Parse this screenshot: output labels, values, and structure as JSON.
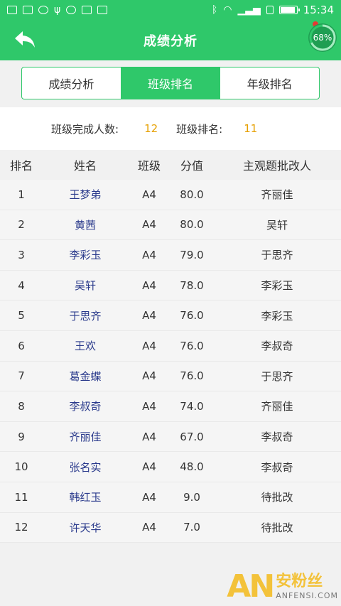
{
  "status_bar": {
    "time": "15:34",
    "battery_level": 0.9,
    "left_icons": [
      "calendar-icon",
      "image-icon",
      "shield-icon",
      "usb-icon",
      "globe-icon",
      "apps-icon",
      "browser-icon"
    ],
    "right_icons": [
      "bluetooth-icon",
      "wifi-icon",
      "signal-icon",
      "sim-icon",
      "battery-icon"
    ]
  },
  "header": {
    "title": "成绩分析",
    "progress_text": "68%",
    "progress_value": 0.68,
    "back_icon": "back-arrow-icon"
  },
  "tabs": [
    {
      "label": "成绩分析",
      "active": false
    },
    {
      "label": "班级排名",
      "active": true
    },
    {
      "label": "年级排名",
      "active": false
    }
  ],
  "summary": {
    "completed_label": "班级完成人数:",
    "completed_value": "12",
    "rank_label": "班级排名:",
    "rank_value": "11"
  },
  "table": {
    "headers": {
      "rank": "排名",
      "name": "姓名",
      "class": "班级",
      "score": "分值",
      "grader": "主观题批改人"
    },
    "rows": [
      {
        "rank": "1",
        "name": "王梦弟",
        "class": "A4",
        "score": "80.0",
        "grader": "齐丽佳"
      },
      {
        "rank": "2",
        "name": "黄茜",
        "class": "A4",
        "score": "80.0",
        "grader": "吴轩"
      },
      {
        "rank": "3",
        "name": "李彩玉",
        "class": "A4",
        "score": "79.0",
        "grader": "于思齐"
      },
      {
        "rank": "4",
        "name": "吴轩",
        "class": "A4",
        "score": "78.0",
        "grader": "李彩玉"
      },
      {
        "rank": "5",
        "name": "于思齐",
        "class": "A4",
        "score": "76.0",
        "grader": "李彩玉"
      },
      {
        "rank": "6",
        "name": "王欢",
        "class": "A4",
        "score": "76.0",
        "grader": "李叔奇"
      },
      {
        "rank": "7",
        "name": "葛金蝶",
        "class": "A4",
        "score": "76.0",
        "grader": "于思齐"
      },
      {
        "rank": "8",
        "name": "李叔奇",
        "class": "A4",
        "score": "74.0",
        "grader": "齐丽佳"
      },
      {
        "rank": "9",
        "name": "齐丽佳",
        "class": "A4",
        "score": "67.0",
        "grader": "李叔奇"
      },
      {
        "rank": "10",
        "name": "张名实",
        "class": "A4",
        "score": "48.0",
        "grader": "李叔奇"
      },
      {
        "rank": "11",
        "name": "韩红玉",
        "class": "A4",
        "score": "9.0",
        "grader": "待批改"
      },
      {
        "rank": "12",
        "name": "许天华",
        "class": "A4",
        "score": "7.0",
        "grader": "待批改"
      }
    ]
  },
  "watermark": {
    "logo": "AN",
    "cn": "安粉丝",
    "en": "ANFENSI.COM"
  },
  "colors": {
    "brand": "#2fc86a",
    "accent_value": "#e6a000",
    "name_link": "#2a3a8c"
  }
}
